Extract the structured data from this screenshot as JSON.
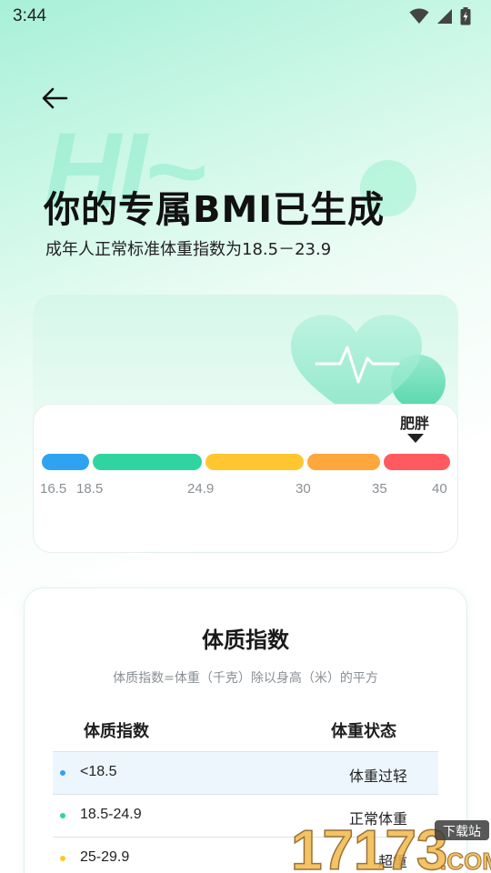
{
  "status_bar": {
    "time": "3:44"
  },
  "header": {
    "watermark_text": "HI~",
    "title": "你的专属BMI已生成",
    "subtitle": "成年人正常标准体重指数为18.5－23.9"
  },
  "bmi_scale": {
    "pointer_label": "肥胖",
    "segments": [
      {
        "name": "underweight",
        "color": "#2ea3f2"
      },
      {
        "name": "normal",
        "color": "#2fd4a1"
      },
      {
        "name": "overweight",
        "color": "#ffc62f"
      },
      {
        "name": "obese-1",
        "color": "#ffa63c"
      },
      {
        "name": "obese-2",
        "color": "#ff5a5f"
      }
    ],
    "ticks": [
      "16.5",
      "18.5",
      "24.9",
      "30",
      "35",
      "40"
    ]
  },
  "info_card": {
    "title": "体质指数",
    "formula": "体质指数=体重（千克）除以身高（米）的平方",
    "columns": [
      "体质指数",
      "体重状态"
    ],
    "rows": [
      {
        "index": "<18.5",
        "status": "体重过轻",
        "dot_color": "#2ea3f2"
      },
      {
        "index": "18.5-24.9",
        "status": "正常体重",
        "dot_color": "#2fd4a1"
      },
      {
        "index": "25-29.9",
        "status": "超重",
        "dot_color": "#ffc62f"
      }
    ]
  },
  "watermark": {
    "brand_digits": "17173",
    "brand_suffix": ".COM",
    "badge": "下载站"
  },
  "colors": {
    "accent": "#2fd4a1",
    "pointer": "#222222"
  }
}
